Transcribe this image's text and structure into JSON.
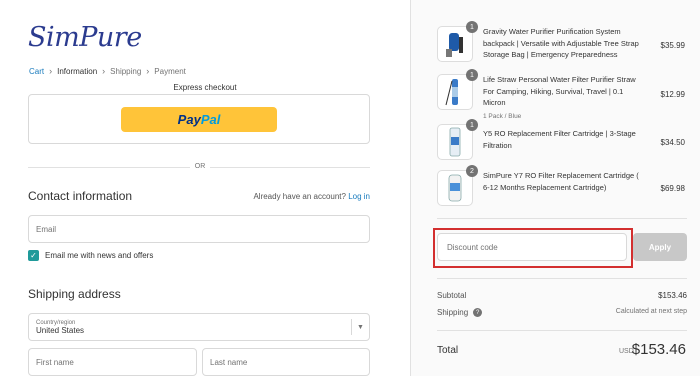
{
  "brand": {
    "logo_text": "SimPure"
  },
  "breadcrumb": {
    "cart": "Cart",
    "information": "Information",
    "shipping": "Shipping",
    "payment": "Payment",
    "separator": "›"
  },
  "express": {
    "title": "Express checkout",
    "paypal_a": "Pay",
    "paypal_b": "Pal",
    "or": "OR"
  },
  "contact": {
    "title": "Contact information",
    "account_prompt": "Already have an account?",
    "login": "Log in",
    "email_placeholder": "Email",
    "newsletter_label": "Email me with news and offers",
    "newsletter_checked": true
  },
  "shipping_address": {
    "title": "Shipping address",
    "country_label": "Country/region",
    "country_value": "United States",
    "first_name_placeholder": "First name",
    "last_name_placeholder": "Last name"
  },
  "cart": {
    "items": [
      {
        "qty": "1",
        "name": "Gravity Water Purifier Purification System backpack | Versatile with Adjustable Tree Strap Storage Bag | Emergency Preparedness",
        "variant": "",
        "price": "$35.99",
        "icon": "backpack-filter-icon"
      },
      {
        "qty": "1",
        "name": "Life Straw Personal Water Filter Purifier Straw For Camping, Hiking, Survival, Travel | 0.1 Micron",
        "variant": "1 Pack / Blue",
        "price": "$12.99",
        "icon": "straw-filter-icon"
      },
      {
        "qty": "1",
        "name": "Y5 RO Replacement Filter Cartridge | 3-Stage Filtration",
        "variant": "",
        "price": "$34.50",
        "icon": "filter-cartridge-icon"
      },
      {
        "qty": "2",
        "name": "SimPure Y7 RO Filter Replacement Cartridge ( 6-12 Months Replacement Cartridge)",
        "variant": "",
        "price": "$69.98",
        "icon": "filter-cartridge-icon"
      }
    ]
  },
  "discount": {
    "placeholder": "Discount code",
    "apply_label": "Apply",
    "highlight_color": "#d32f2f"
  },
  "summary": {
    "subtotal_label": "Subtotal",
    "subtotal_value": "$153.46",
    "shipping_label": "Shipping",
    "shipping_help": "?",
    "shipping_value": "Calculated at next step",
    "total_label": "Total",
    "currency": "USD",
    "total_value": "$153.46"
  },
  "colors": {
    "link": "#197bbd",
    "paypal": "#ffc439",
    "checkbox": "#1f9a9a"
  }
}
